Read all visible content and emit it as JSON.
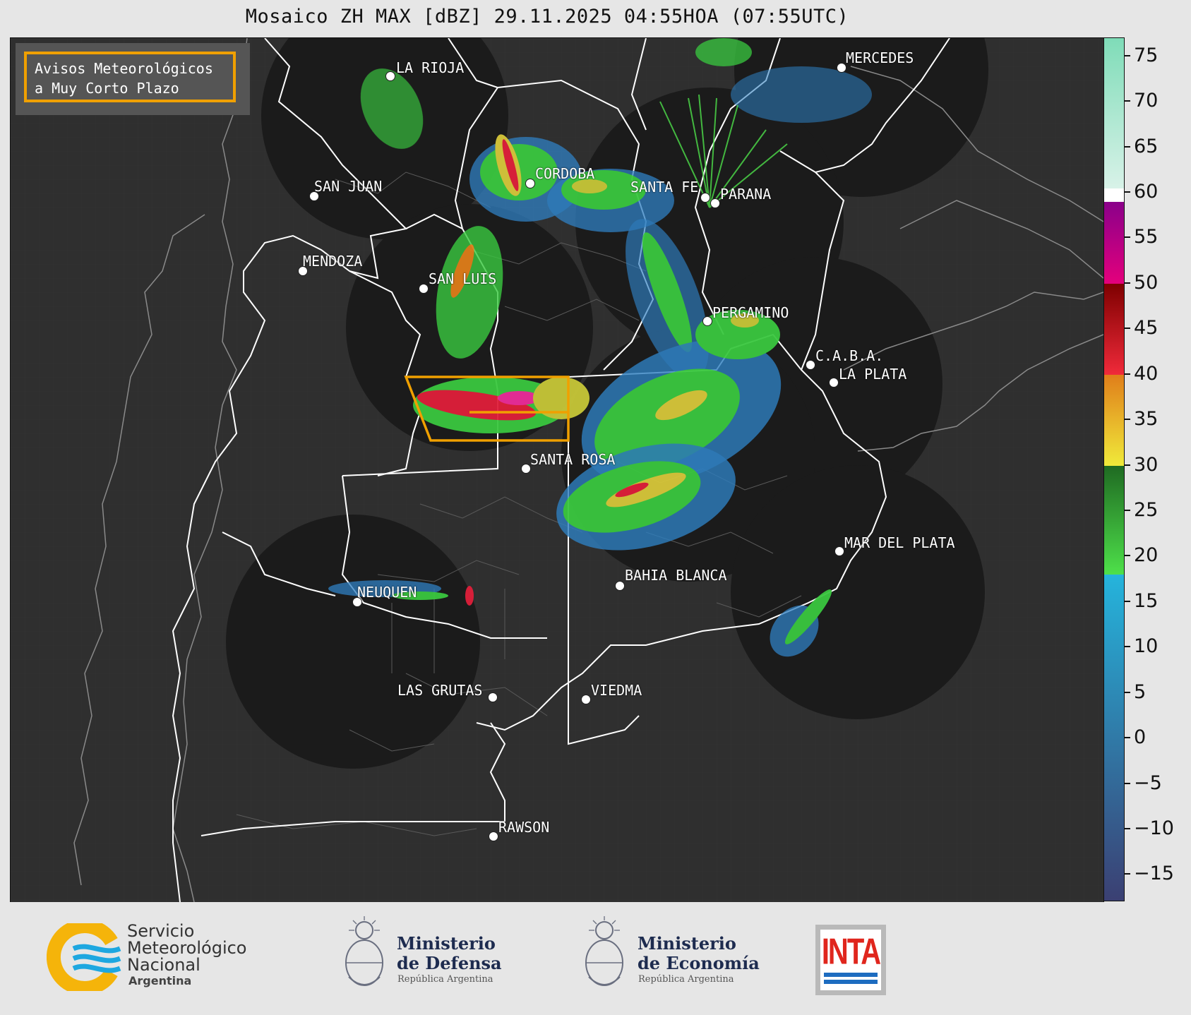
{
  "title": "Mosaico ZH MAX [dBZ] 29.11.2025 04:55HOA (07:55UTC)",
  "alert_legend": {
    "line1": "Avisos Meteorológicos",
    "line2": "a Muy Corto Plazo",
    "color": "#f0a000"
  },
  "cities": [
    {
      "name": "LA RIOJA"
    },
    {
      "name": "SAN JUAN"
    },
    {
      "name": "CORDOBA"
    },
    {
      "name": "SANTA FE"
    },
    {
      "name": "PARANA"
    },
    {
      "name": "MERCEDES"
    },
    {
      "name": "MENDOZA"
    },
    {
      "name": "SAN LUIS"
    },
    {
      "name": "PERGAMINO"
    },
    {
      "name": "C.A.B.A."
    },
    {
      "name": "LA PLATA"
    },
    {
      "name": "SANTA ROSA"
    },
    {
      "name": "MAR DEL PLATA"
    },
    {
      "name": "BAHIA BLANCA"
    },
    {
      "name": "NEUQUEN"
    },
    {
      "name": "LAS GRUTAS"
    },
    {
      "name": "VIEDMA"
    },
    {
      "name": "RAWSON"
    }
  ],
  "colorbar": {
    "unit": "dBZ",
    "range": [
      -18,
      77
    ],
    "ticks": [
      "75",
      "70",
      "65",
      "60",
      "55",
      "50",
      "45",
      "40",
      "35",
      "30",
      "25",
      "20",
      "15",
      "10",
      "5",
      "0",
      "−5",
      "−10",
      "−15"
    ],
    "bands": [
      {
        "from": -18,
        "to": 18,
        "from_color": "#3b3f72",
        "to_color": "#25b4dc"
      },
      {
        "from": 18,
        "to": 30,
        "from_color": "#4ee04a",
        "to_color": "#1f6a22"
      },
      {
        "from": 30,
        "to": 40,
        "from_color": "#f0ea3a",
        "to_color": "#e07e1a"
      },
      {
        "from": 40,
        "to": 50,
        "from_color": "#f02a3a",
        "to_color": "#7e0000"
      },
      {
        "from": 50,
        "to": 59,
        "from_color": "#e4007c",
        "to_color": "#8a008a"
      },
      {
        "from": 59,
        "to": 60.5,
        "from_color": "#ffffff",
        "to_color": "#ffffff"
      },
      {
        "from": 60.5,
        "to": 77,
        "from_color": "#d8f2e8",
        "to_color": "#7fdcb8"
      }
    ]
  },
  "logos": {
    "smn": {
      "line1": "Servicio",
      "line2": "Meteorológico",
      "line3": "Nacional",
      "line4": "Argentina"
    },
    "defensa": {
      "line1": "Ministerio",
      "line2": "de Defensa",
      "line3": "República Argentina"
    },
    "economia": {
      "line1": "Ministerio",
      "line2": "de Economía",
      "line3": "República Argentina"
    },
    "inta": {
      "text": "INTA"
    }
  }
}
